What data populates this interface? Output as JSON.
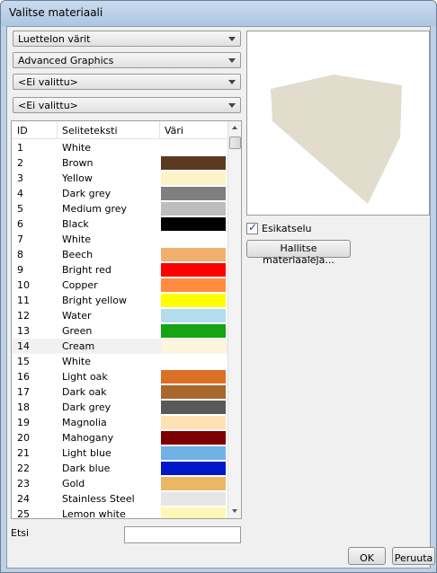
{
  "window": {
    "title": "Valitse materiaali"
  },
  "combos": [
    {
      "value": "Luettelon värit"
    },
    {
      "value": "Advanced Graphics"
    },
    {
      "value": "<Ei valittu>"
    },
    {
      "value": "<Ei valittu>"
    }
  ],
  "table": {
    "headers": {
      "id": "ID",
      "text": "Seliteteksti",
      "color": "Väri"
    },
    "rows": [
      {
        "id": "1",
        "text": "White",
        "color": "#ffffff"
      },
      {
        "id": "2",
        "text": "Brown",
        "color": "#5c3a21"
      },
      {
        "id": "3",
        "text": "Yellow",
        "color": "#fdf3c6"
      },
      {
        "id": "4",
        "text": "Dark grey",
        "color": "#7f7f7f"
      },
      {
        "id": "5",
        "text": "Medium grey",
        "color": "#bdbdbd"
      },
      {
        "id": "6",
        "text": "Black",
        "color": "#000000"
      },
      {
        "id": "7",
        "text": "White",
        "color": "#ffffff"
      },
      {
        "id": "8",
        "text": "Beech",
        "color": "#f2b06e"
      },
      {
        "id": "9",
        "text": "Bright red",
        "color": "#ff0000"
      },
      {
        "id": "10",
        "text": "Copper",
        "color": "#ff8b41"
      },
      {
        "id": "11",
        "text": "Bright yellow",
        "color": "#ffff00"
      },
      {
        "id": "12",
        "text": "Water",
        "color": "#b3dcec"
      },
      {
        "id": "13",
        "text": "Green",
        "color": "#16a314"
      },
      {
        "id": "14",
        "text": "Cream",
        "color": "#fff4dc"
      },
      {
        "id": "15",
        "text": "White",
        "color": "#ffffff"
      },
      {
        "id": "16",
        "text": "Light oak",
        "color": "#dc6f26"
      },
      {
        "id": "17",
        "text": "Dark oak",
        "color": "#a9672d"
      },
      {
        "id": "18",
        "text": "Dark grey",
        "color": "#595959"
      },
      {
        "id": "19",
        "text": "Magnolia",
        "color": "#ffe1b6"
      },
      {
        "id": "20",
        "text": "Mahogany",
        "color": "#7d0000"
      },
      {
        "id": "21",
        "text": "Light blue",
        "color": "#70b1e6"
      },
      {
        "id": "22",
        "text": "Dark blue",
        "color": "#0018c8"
      },
      {
        "id": "23",
        "text": "Gold",
        "color": "#ebb763"
      },
      {
        "id": "24",
        "text": "Stainless Steel",
        "color": "#e6e6e6"
      },
      {
        "id": "25",
        "text": "Lemon white",
        "color": "#fff7b5"
      }
    ],
    "selected_id": "14"
  },
  "preview": {
    "cube_color": "#e2dccd"
  },
  "preview_checkbox": {
    "label": "Esikatselu",
    "checked": true
  },
  "manage_button": {
    "label": "Hallitse materiaaleja..."
  },
  "search": {
    "label": "Etsi",
    "value": ""
  },
  "buttons": {
    "ok": "OK",
    "cancel": "Peruuta"
  }
}
